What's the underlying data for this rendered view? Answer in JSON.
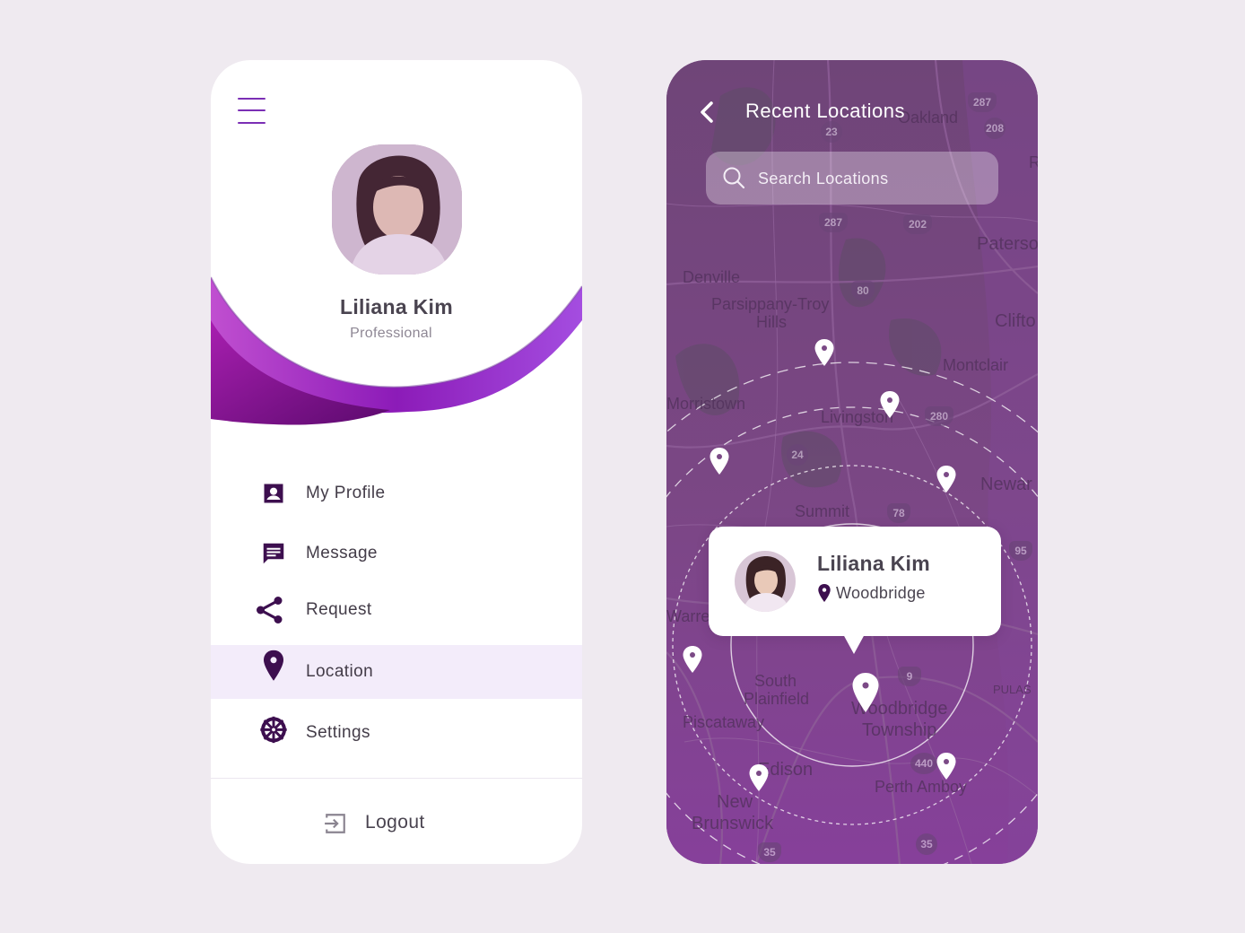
{
  "profile": {
    "name": "Liliana Kim",
    "role": "Professional"
  },
  "menu": {
    "items": [
      {
        "label": "My Profile",
        "icon": "account-box-icon",
        "active": false
      },
      {
        "label": "Message",
        "icon": "message-icon",
        "active": false
      },
      {
        "label": "Request",
        "icon": "share-icon",
        "active": false
      },
      {
        "label": "Location",
        "icon": "location-pin-icon",
        "active": true
      },
      {
        "label": "Settings",
        "icon": "settings-wheel-icon",
        "active": false
      }
    ],
    "logout_label": "Logout"
  },
  "map_screen": {
    "title": "Recent Locations",
    "search_placeholder": "Search Locations",
    "card": {
      "name": "Liliana Kim",
      "location": "Woodbridge"
    },
    "map_labels": [
      "Oakland",
      "Paterso",
      "Denville",
      "Parsippany-Troy",
      "Hills",
      "Clifto",
      "Montclair",
      "Morristown",
      "Livingston",
      "Newar",
      "Summit",
      "South",
      "Plainfield",
      "Piscataway",
      "Woodbridge",
      "Township",
      "Edison",
      "Perth Amboy",
      "New",
      "Brunswick",
      "Warren",
      "R",
      "PULAS"
    ],
    "road_shields": [
      "287",
      "208",
      "23",
      "287",
      "202",
      "80",
      "280",
      "24",
      "78",
      "95",
      "9",
      "440",
      "35",
      "35"
    ]
  },
  "colors": {
    "accent": "#7b2fb5",
    "icon_dark": "#3d0f4f",
    "active_row": "#f3ecfa",
    "map_tint": "#7c4a86"
  }
}
